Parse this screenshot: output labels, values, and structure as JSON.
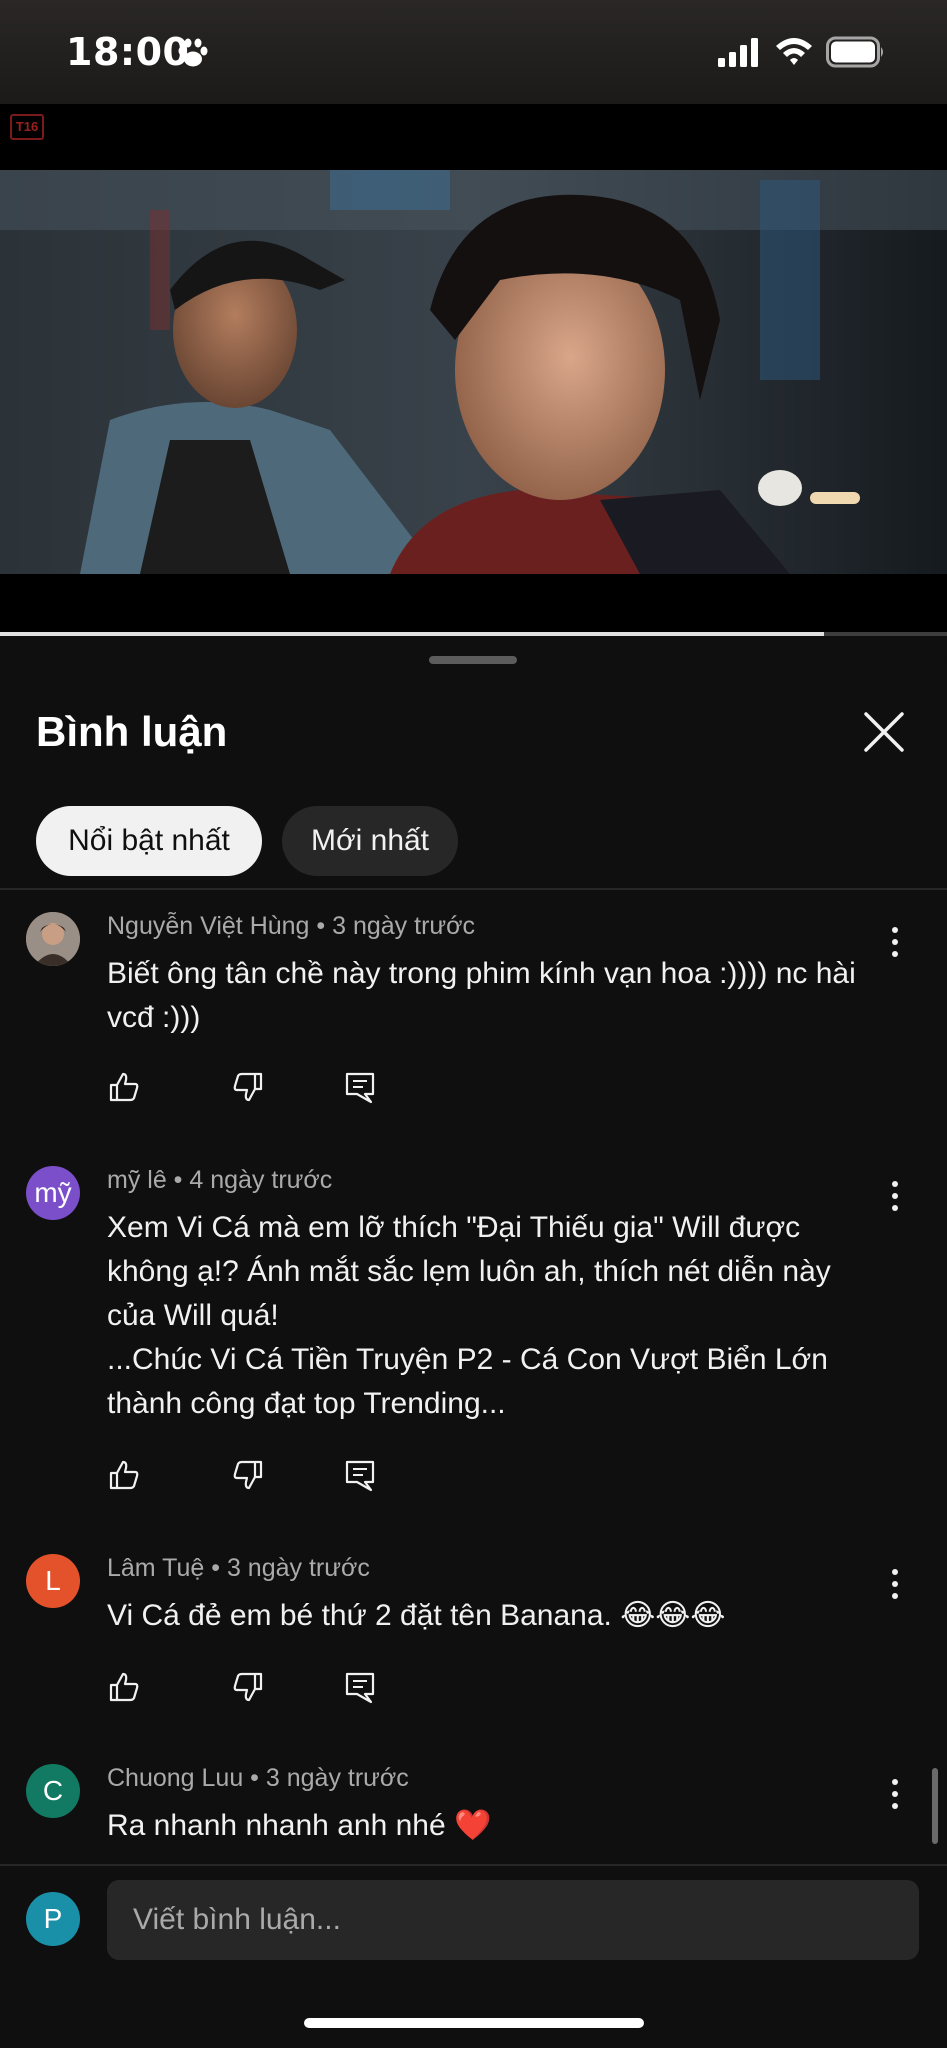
{
  "status_bar": {
    "time": "18:00",
    "icons": [
      "paw-icon",
      "signal-icon",
      "wifi-icon",
      "battery-icon"
    ]
  },
  "video": {
    "rating_badge": "T16",
    "progress_fraction": 0.87
  },
  "comments_panel": {
    "title": "Bình luận",
    "chips": [
      "Nổi bật nhất",
      "Mới nhất"
    ],
    "selected_chip": "Nổi bật nhất",
    "comments": [
      {
        "author": "Nguyễn Việt Hùng",
        "time": "3 ngày trước",
        "avatar_letter": "",
        "text": "Biết ông tân chề này trong phim kính vạn hoa :)))) nc hài vcđ :)))"
      },
      {
        "author": "mỹ lê",
        "time": "4 ngày trước",
        "avatar_letter": "mỹ",
        "avatar_color": "#7b4fc9",
        "text": "Xem Vi Cá mà em lỡ thích \"Đại Thiếu gia\" Will được không ạ!? Ánh mắt sắc lẹm luôn ah, thích nét diễn này của Will quá!\n...Chúc Vi Cá Tiền Truyện P2 - Cá Con Vượt Biển Lớn thành công đạt top Trending..."
      },
      {
        "author": "Lâm Tuệ",
        "time": "3 ngày trước",
        "avatar_letter": "L",
        "avatar_color": "#e4522c",
        "text": "Vi Cá đẻ em bé thứ 2 đặt tên Banana. 😂😂😂"
      },
      {
        "author": "Chuong Luu",
        "time": "3 ngày trước",
        "avatar_letter": "C",
        "avatar_color": "#127a62",
        "text": "Ra nhanh nhanh anh nhé ❤️"
      }
    ]
  },
  "composer": {
    "avatar_letter": "P",
    "placeholder": "Viết bình luận..."
  }
}
